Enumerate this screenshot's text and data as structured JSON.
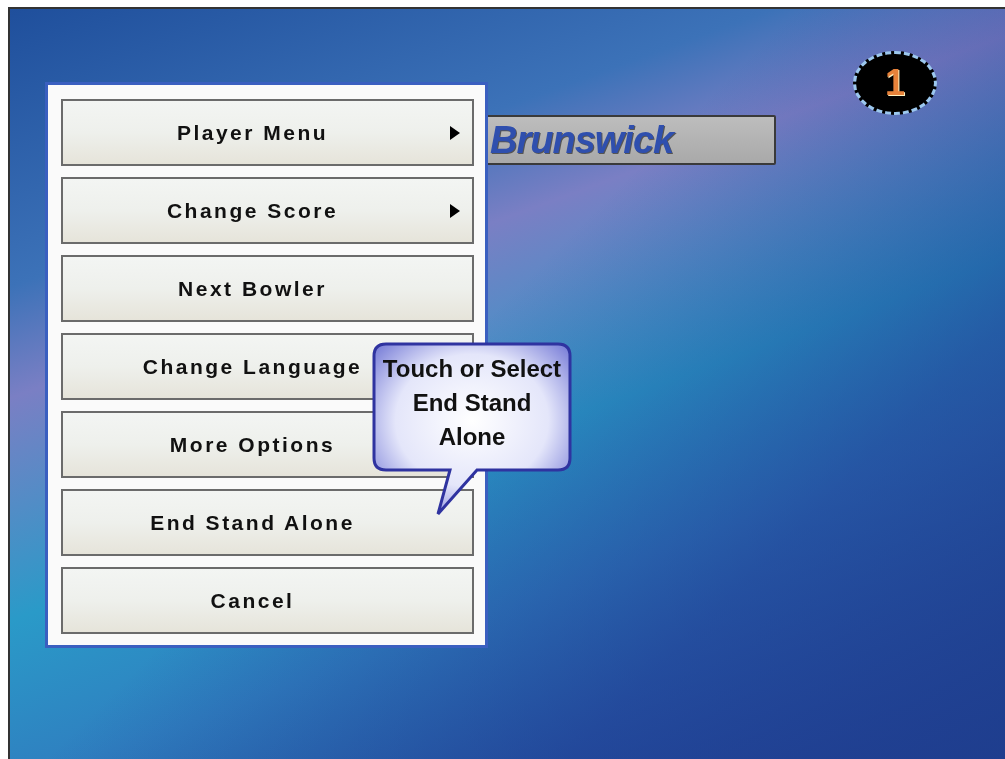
{
  "logo": {
    "text": "Brunswick"
  },
  "lane_badge": {
    "text": "1"
  },
  "menu": {
    "items": [
      {
        "label": "Player Menu",
        "submenu": true
      },
      {
        "label": "Change Score",
        "submenu": true
      },
      {
        "label": "Next Bowler",
        "submenu": false
      },
      {
        "label": "Change Language",
        "submenu": false
      },
      {
        "label": "More Options",
        "submenu": false
      },
      {
        "label": "End Stand Alone",
        "submenu": false
      },
      {
        "label": "Cancel",
        "submenu": false
      }
    ]
  },
  "callout": {
    "text": "Touch or Select End Stand Alone"
  }
}
